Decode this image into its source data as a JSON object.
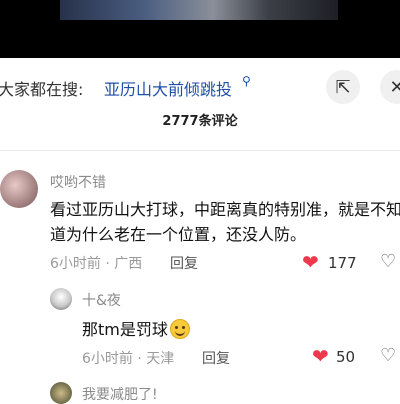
{
  "search": {
    "prefix": "大家都在搜:",
    "term": "亚历山大前倾跳投",
    "term_icon": "search-icon"
  },
  "header": {
    "comment_count": "2777条评论"
  },
  "comments": [
    {
      "username": "哎哟不错",
      "text": "看过亚历山大打球，中距离真的特别准，就是不知道为什么老在一个位置，还没人防。",
      "time_location": "6小时前 · 广西",
      "reply_label": "回复",
      "likes": "177"
    },
    {
      "username": "十&夜",
      "text": "那tm是罚球",
      "emoji": "grinning-emoji",
      "time_location": "6小时前 · 天津",
      "reply_label": "回复",
      "likes": "50"
    },
    {
      "username": "我要减肥了!"
    }
  ],
  "colors": {
    "accent_link": "#1f4fa8",
    "like_heart": "#f0384c"
  }
}
